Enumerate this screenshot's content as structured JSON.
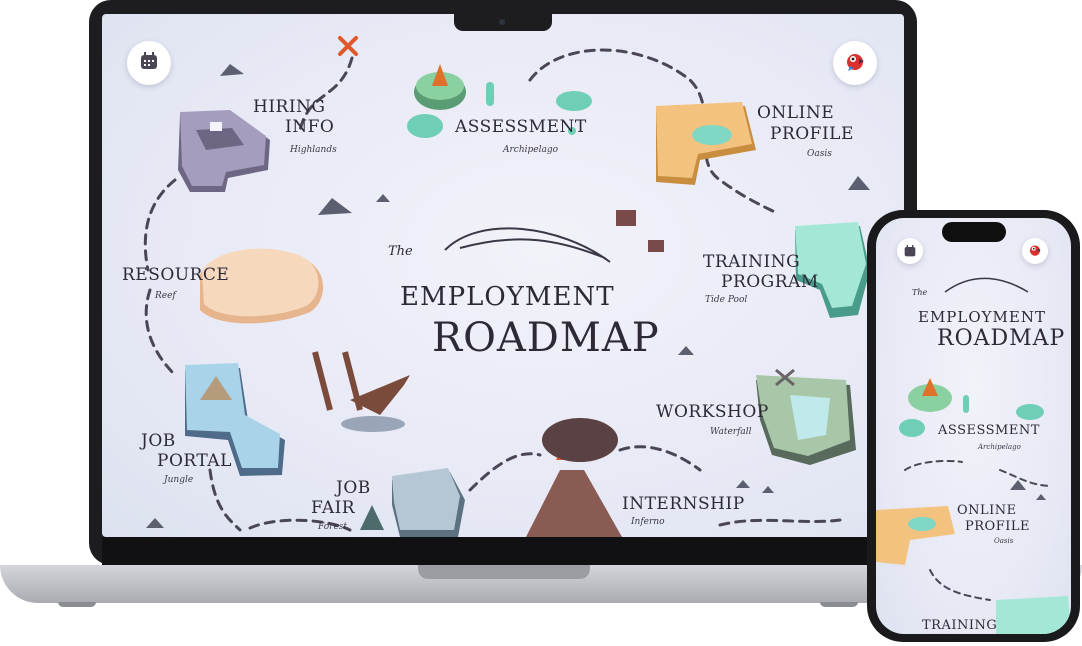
{
  "title": {
    "the": "The",
    "line1": "Employment",
    "line2": "Roadmap"
  },
  "controls": {
    "left_icon": "calendar-icon",
    "right_icon": "parrot-avatar-icon"
  },
  "locations": {
    "hiring_info": {
      "name1": "Hiring",
      "name2": "Info",
      "sub": "Highlands"
    },
    "assessment": {
      "name": "Assessment",
      "sub": "Archipelago"
    },
    "online_profile": {
      "name1": "Online",
      "name2": "Profile",
      "sub": "Oasis"
    },
    "training_program": {
      "name1": "Training",
      "name2": "Program",
      "sub": "Tide Pool"
    },
    "resource": {
      "name": "Resource",
      "sub": "Reef"
    },
    "job_portal": {
      "name1": "Job",
      "name2": "Portal",
      "sub": "Jungle"
    },
    "workshop": {
      "name": "Workshop",
      "sub": "Waterfall"
    },
    "job_fair": {
      "name1": "Job",
      "name2": "Fair",
      "sub": "Forest"
    },
    "internship": {
      "name": "Internship",
      "sub": "Inferno"
    }
  },
  "phone_partial_label": "Training",
  "colors": {
    "background": "#e7e9f5",
    "text": "#2d2a36",
    "sand": "#f2c27e",
    "water": "#7fd7c4",
    "stone": "#8d87a3",
    "lava": "#e0572b"
  }
}
